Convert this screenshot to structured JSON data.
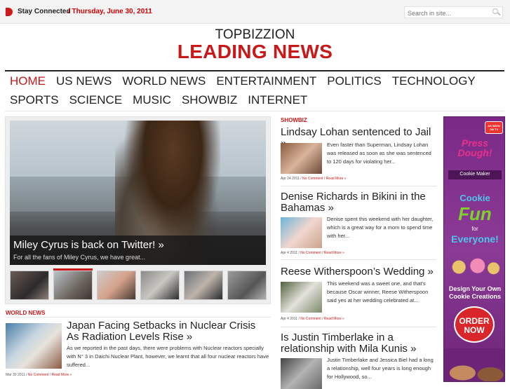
{
  "topbar": {
    "stay_connected": "Stay Connected",
    "date": "/ Thursday, June 30, 2011",
    "search_placeholder": "Search in site..."
  },
  "site": {
    "name": "TOPBIZZION",
    "tagline": "LEADING NEWS"
  },
  "nav": {
    "row1": [
      "HOME",
      "US NEWS",
      "WORLD NEWS",
      "ENTERTAINMENT",
      "POLITICS",
      "TECHNOLOGY"
    ],
    "row2": [
      "SPORTS",
      "SCIENCE",
      "MUSIC",
      "SHOWBIZ",
      "INTERNET"
    ],
    "active": "HOME"
  },
  "slider": {
    "title": "Miley Cyrus is back on Twitter! »",
    "text": "For all the fans of Miley Cyrus, we have great..."
  },
  "world_news": {
    "label": "WORLD NEWS",
    "title": "Japan Facing Setbacks in Nuclear Crisis As Radiation Levels Rise »",
    "text": "As we reported in the past days, there were  problems with Nuclear reactors specially with N° 3 in Daichi Nuclear Plant, however, we learnt  that all four nuclear reactors have suffered...",
    "date": "Mar 30 2011",
    "comments": "No Comment",
    "read_more": "Read More »"
  },
  "showbiz": {
    "label": "SHOWBIZ",
    "articles": [
      {
        "title": "Lindsay Lohan sentenced to Jail »",
        "text": "Even faster than Superman, Lindsay Lohan was released as soon as she was sentenced to 120 days for violating her...",
        "date": "Apr 24 2011",
        "comments": "No Comment",
        "read_more": "Read More »"
      },
      {
        "title": "Denise Richards in Bikini in the Bahamas »",
        "text": "Denise spent this weekend with her daughter, which is a great way for a mom to spend time with her...",
        "date": "Apr 4 2011",
        "comments": "No Comment",
        "read_more": "Read More »"
      },
      {
        "title": "Reese Witherspoon’s Wedding »",
        "text": "This weekend was a sweet one, and that's because Oscar winner, Reese Witherspoon said yes at her wedding celebrated at...",
        "date": "Apr 4 2011",
        "comments": "No Comment",
        "read_more": "Read More »"
      },
      {
        "title": "Is Justin Timberlake in a relationship with Mila Kunis »",
        "text": "  Justin Timberlake and Jessica Biel had a long a relationship, well four years is long enough for Hollywood, so..."
      }
    ]
  },
  "ad": {
    "tv": "AS SEEN ON TV",
    "brand": "Press Dough!",
    "product": "Cookie Maker",
    "cookie": "Cookie",
    "fun": "Fun",
    "for": "for",
    "everyone": "Everyone!",
    "design": "Design Your Own Cookie Creations",
    "order": "ORDER NOW"
  }
}
